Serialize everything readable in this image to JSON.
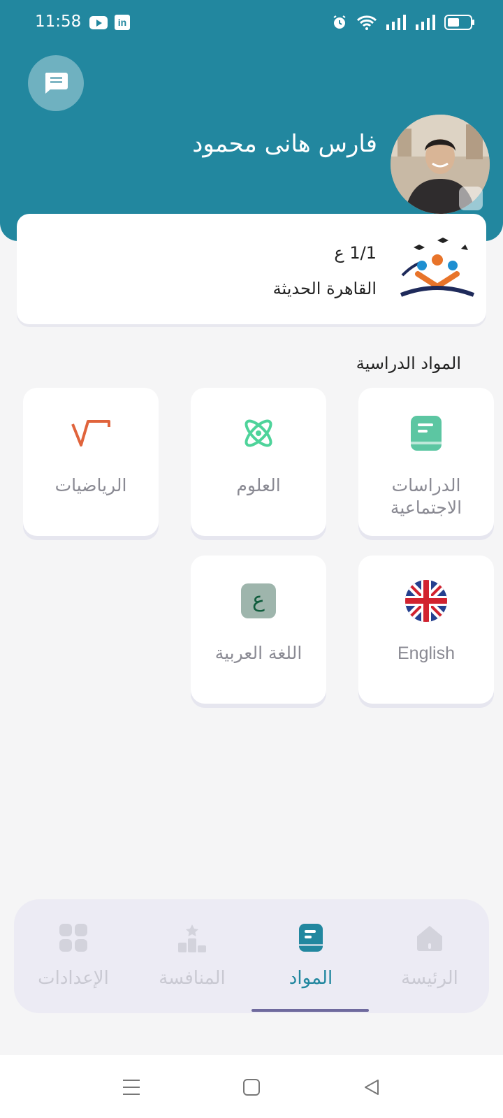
{
  "status_bar": {
    "time": "11:58",
    "linkedin_glyph": "in",
    "icons": [
      "youtube-icon",
      "linkedin-icon",
      "alarm-icon",
      "wifi-icon",
      "signal-icon",
      "battery-icon"
    ]
  },
  "header": {
    "user_name": "فارس هانى محمود",
    "chat_icon": "chat-icon",
    "color": "#22879f"
  },
  "school_card": {
    "class": "1/1 ع",
    "school": "القاهرة الحديثة"
  },
  "subjects_section": {
    "title": "المواد الدراسية",
    "items": [
      {
        "label": "الدراسات الاجتماعية",
        "icon": "book-icon",
        "color": "#5cc6a2"
      },
      {
        "label": "العلوم",
        "icon": "atom-icon",
        "color": "#4ed39a"
      },
      {
        "label": "الرياضيات",
        "icon": "square-root-icon",
        "color": "#e0643c"
      },
      {
        "label": "English",
        "icon": "uk-flag-icon"
      },
      {
        "label": "اللغة العربية",
        "icon": "arabic-letter-icon",
        "glyph": "ع",
        "color": "#9eb5ac"
      }
    ]
  },
  "bottom_nav": {
    "items": [
      {
        "label": "الرئيسة",
        "icon": "home-icon",
        "active": false
      },
      {
        "label": "المواد",
        "icon": "book-icon",
        "active": true
      },
      {
        "label": "المنافسة",
        "icon": "podium-icon",
        "active": false
      },
      {
        "label": "الإعدادات",
        "icon": "grid-icon",
        "active": false
      }
    ],
    "active_color": "#22879f",
    "inactive_color": "#c9c9d2"
  },
  "system_nav": [
    "menu-icon",
    "home-square-icon",
    "back-icon"
  ]
}
